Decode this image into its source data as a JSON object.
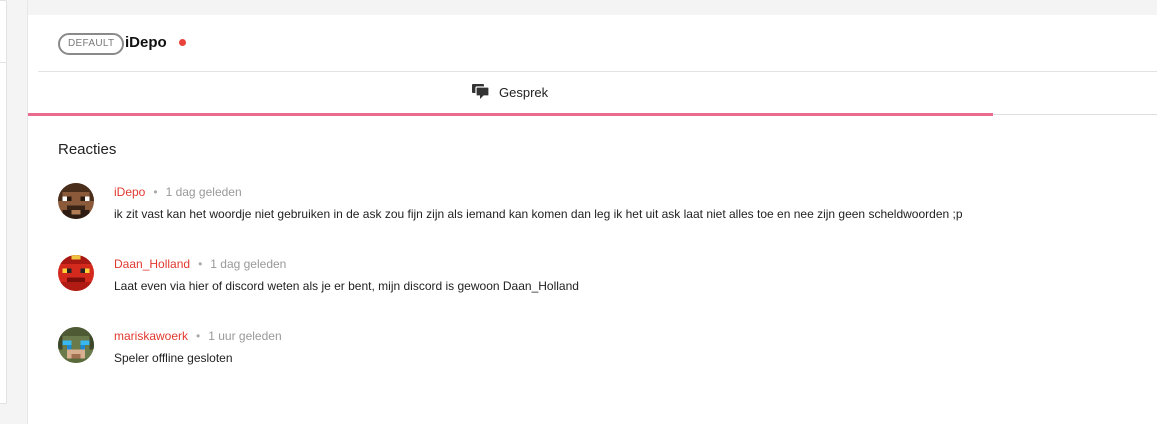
{
  "header": {
    "badge": "DEFAULT",
    "title": "iDepo",
    "status_color": "#e8423a"
  },
  "tabs": [
    {
      "label": "Gesprek",
      "icon": "chat-bubbles-icon",
      "active": true
    }
  ],
  "comments_section": {
    "title": "Reacties",
    "items": [
      {
        "author": "iDepo",
        "separator": "•",
        "time": "1 dag geleden",
        "text": "ik zit vast kan het woordje niet gebruiken in de ask zou fijn zijn als iemand kan komen dan leg ik het uit ask laat niet alles toe en nee zijn geen scheldwoorden ;p",
        "avatar": "avatar-brown-skin"
      },
      {
        "author": "Daan_Holland",
        "separator": "•",
        "time": "1 dag geleden",
        "text": "Laat even via hier of discord weten als je er bent, mijn discord is gewoon Daan_Holland",
        "avatar": "avatar-red-skin"
      },
      {
        "author": "mariskawoerk",
        "separator": "•",
        "time": "1 uur geleden",
        "text": "Speler offline gesloten",
        "avatar": "avatar-blue-face-skin"
      }
    ]
  },
  "colors": {
    "accent": "#e96b8d",
    "author": "#e0392f"
  }
}
